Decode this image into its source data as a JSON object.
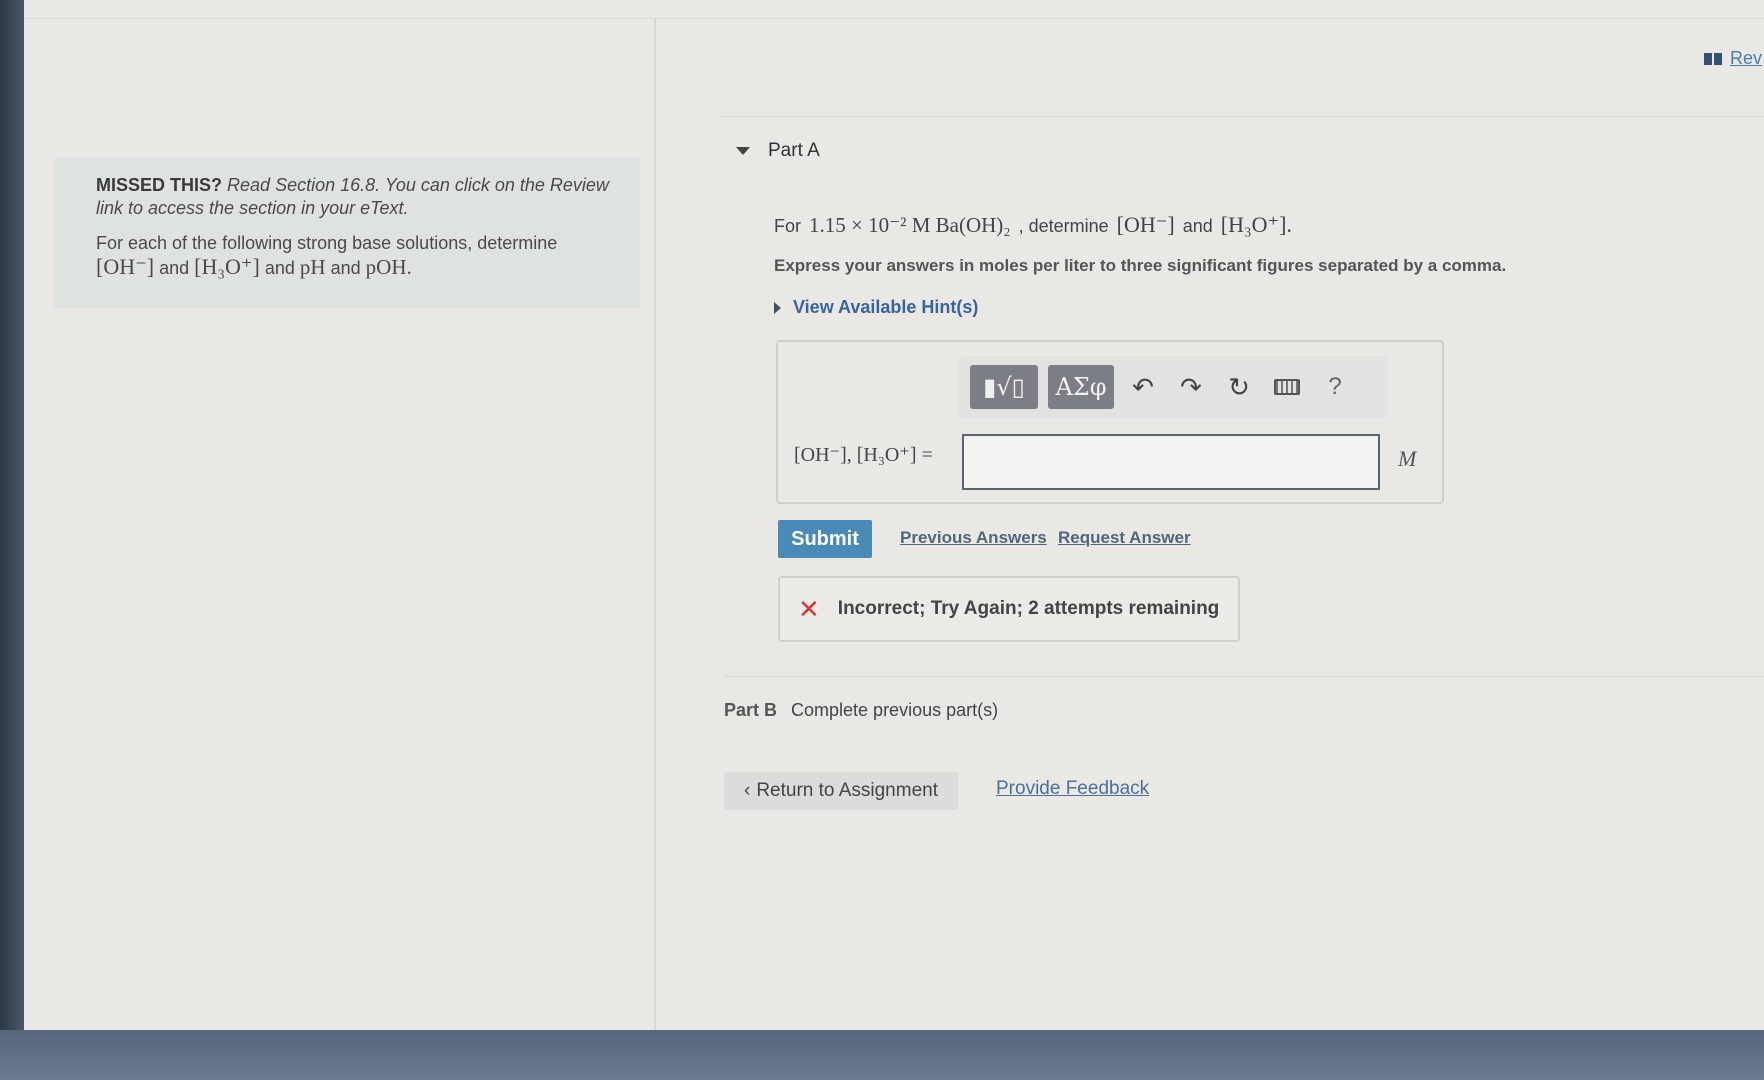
{
  "header": {
    "review_link": "Rev"
  },
  "missed": {
    "strong": "MISSED THIS?",
    "italic": "Read Section 16.8. You can click on the Review link to access the section in your eText.",
    "line1": "For each of the following strong base solutions, determine",
    "oh": "[OH⁻]",
    "and1": "and",
    "h3o": "[H₃O⁺]",
    "and2": "and",
    "ph": "pH",
    "and3": "and",
    "poh": "pOH."
  },
  "part_a": {
    "label": "Part A",
    "question": {
      "for": "For",
      "value": "1.15 × 10⁻² M Ba(OH)₂",
      "sep": ", determine",
      "oh": "[OH⁻]",
      "and": "and",
      "h3o": "[H₃O⁺]."
    },
    "instruction": "Express your answers in moles per liter to three significant figures separated by a comma.",
    "hint": "View Available Hint(s)",
    "toolbar": {
      "templates": "▮√▯",
      "symbols": "ΑΣφ",
      "undo": "↶",
      "redo": "↷",
      "reset": "↻",
      "help": "?"
    },
    "answer_label": "[OH⁻], [H₃O⁺] =",
    "answer_value": "",
    "unit": "M",
    "submit": "Submit",
    "previous_answers": "Previous Answers",
    "request_answer": "Request Answer",
    "feedback": "Incorrect; Try Again; 2 attempts remaining"
  },
  "part_b": {
    "label": "Part B",
    "text": "Complete previous part(s)"
  },
  "footer": {
    "return": "Return to Assignment",
    "feedback": "Provide Feedback"
  }
}
